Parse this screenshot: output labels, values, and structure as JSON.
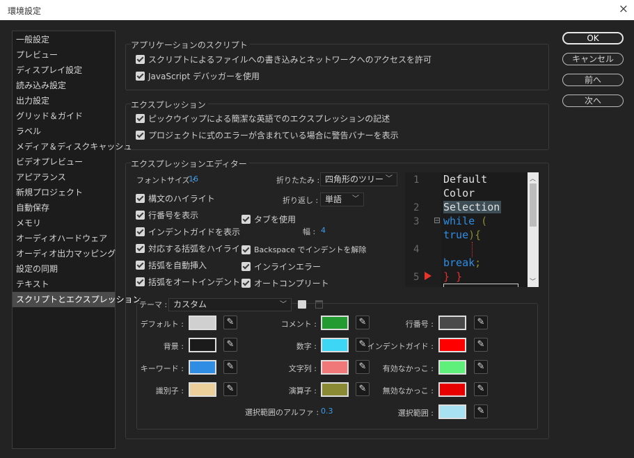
{
  "window": {
    "title": "環境設定",
    "close_icon": "×"
  },
  "sidebar": {
    "items": [
      {
        "label": "一般設定"
      },
      {
        "label": "プレビュー"
      },
      {
        "label": "ディスプレイ設定"
      },
      {
        "label": "読み込み設定"
      },
      {
        "label": "出力設定"
      },
      {
        "label": "グリッド＆ガイド"
      },
      {
        "label": "ラベル"
      },
      {
        "label": "メディア＆ディスクキャッシュ"
      },
      {
        "label": "ビデオプレビュー"
      },
      {
        "label": "アピアランス"
      },
      {
        "label": "新規プロジェクト"
      },
      {
        "label": "自動保存"
      },
      {
        "label": "メモリ"
      },
      {
        "label": "オーディオハードウェア"
      },
      {
        "label": "オーディオ出力マッピング"
      },
      {
        "label": "設定の同期"
      },
      {
        "label": "テキスト"
      },
      {
        "label": "スクリプトとエクスプレッション",
        "selected": true
      }
    ]
  },
  "buttons": {
    "ok": "OK",
    "cancel": "キャンセル",
    "prev": "前へ",
    "next": "次へ"
  },
  "app_scripts": {
    "title": "アプリケーションのスクリプト",
    "allow_network": "スクリプトによるファイルへの書き込みとネットワークへのアクセスを許可",
    "js_debugger": "JavaScript デバッガーを使用"
  },
  "expressions": {
    "title": "エクスプレッション",
    "pickwhip_english": "ピックウイップによる簡潔な英語でのエクスプレッションの記述",
    "warning_banner": "プロジェクトに式のエラーが含まれている場合に警告バナーを表示"
  },
  "editor": {
    "title": "エクスプレッションエディター",
    "font_size_label": "フォントサイズ :",
    "font_size_value": "16",
    "fold_label": "折りたたみ :",
    "fold_value": "四角形のツリー",
    "wrap_label": "折り返し :",
    "wrap_value": "単語",
    "tab_width_label": "幅 :",
    "tab_width_value": "4",
    "syntax_highlight": "構文のハイライト",
    "show_line_numbers": "行番号を表示",
    "show_indent_guides": "インデントガイドを表示",
    "highlight_brackets": "対応する括弧をハイライト",
    "auto_insert_brackets": "括弧を自動挿入",
    "auto_indent_brackets": "括弧をオートインデント",
    "use_tabs": "タブを使用",
    "backspace_unindent": "Backspace でインデントを解除",
    "inline_errors": "インラインエラー",
    "autocomplete": "オートコンプリート"
  },
  "preview": {
    "line_numbers": [
      "1",
      "2",
      "3",
      "4",
      "5"
    ],
    "fold_marker": "⊟",
    "error_marker_icon": "error-arrow-icon",
    "code": {
      "default": "Default",
      "color": "Color",
      "selection": "Selection",
      "while": "while",
      "paren_open": " (",
      "true": "true",
      "close_brace": "){",
      "break": "break",
      "semicolon": ";",
      "end_braces": "} }"
    }
  },
  "theme": {
    "label": "テーマ :",
    "value": "カスタム",
    "save_icon": "save-icon",
    "delete_icon": "trash-icon",
    "colors": [
      {
        "label": "デフォルト :",
        "color": "#d0d0d0"
      },
      {
        "label": "背景 :",
        "color": "#1b1b1b"
      },
      {
        "label": "キーワード :",
        "color": "#2f8de4"
      },
      {
        "label": "識別子 :",
        "color": "#ecd09b"
      },
      {
        "label": "コメント :",
        "color": "#239b30"
      },
      {
        "label": "数字 :",
        "color": "#3ed6f5"
      },
      {
        "label": "文字列 :",
        "color": "#f07878"
      },
      {
        "label": "演算子 :",
        "color": "#8a8a34"
      },
      {
        "label": "行番号 :",
        "color": "#4a4a4a"
      },
      {
        "label": "インデントガイド :",
        "color": "#ff0000"
      },
      {
        "label": "有効なかっこ :",
        "color": "#5ef07a"
      },
      {
        "label": "無効なかっこ :",
        "color": "#e80000"
      },
      {
        "label": "選択範囲 :",
        "color": "#a8e2f2"
      }
    ],
    "selection_alpha_label": "選択範囲のアルファ :",
    "selection_alpha_value": "0.3"
  }
}
